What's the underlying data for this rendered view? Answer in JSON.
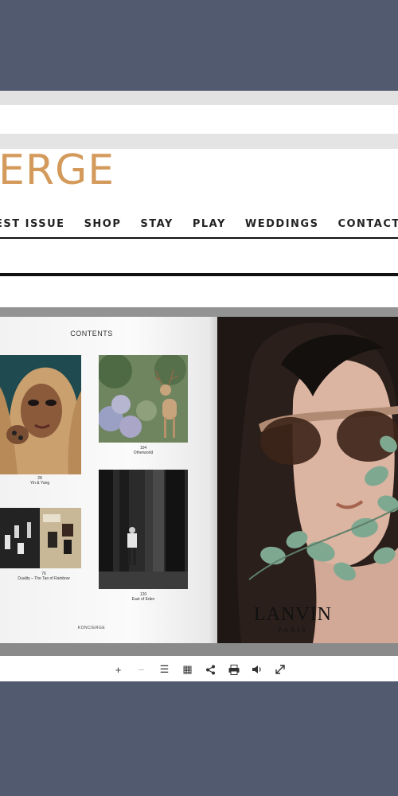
{
  "site": {
    "logo_text": "ERGE",
    "nav": [
      "EST ISSUE",
      "SHOP",
      "STAY",
      "PLAY",
      "WEDDINGS",
      "CONTACT"
    ]
  },
  "magazine": {
    "contents_title": "CONTENTS",
    "items": [
      {
        "page": "28",
        "title": "Yin & Yang"
      },
      {
        "page": "104",
        "title": "Otherworld"
      },
      {
        "page": "76",
        "title": "Duality – The Tao of Rainbow"
      },
      {
        "page": "120",
        "title": "East of Eden"
      }
    ],
    "footer_brand": "KONCIERGE",
    "ad_brand": "LANVIN",
    "ad_sub": "PARIS"
  },
  "toolbar": {
    "buttons": [
      {
        "name": "zoom-in-icon",
        "glyph": "+"
      },
      {
        "name": "zoom-out-icon",
        "glyph": "−"
      },
      {
        "name": "table-of-contents-icon",
        "glyph": "☰"
      },
      {
        "name": "thumbnails-icon",
        "glyph": "▦"
      },
      {
        "name": "share-icon",
        "glyph": "⭢"
      },
      {
        "name": "print-icon",
        "glyph": "⎙"
      },
      {
        "name": "sound-icon",
        "glyph": "🔈"
      },
      {
        "name": "fullscreen-icon",
        "glyph": "⤢"
      }
    ]
  },
  "colors": {
    "logo": "#d49a5c",
    "background": "#525a6f"
  }
}
